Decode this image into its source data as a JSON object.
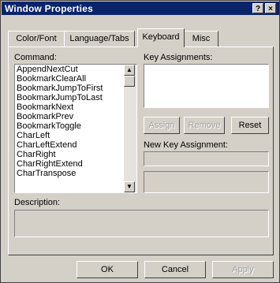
{
  "window": {
    "title": "Window Properties",
    "help_label": "?",
    "close_label": "×"
  },
  "tabs": [
    {
      "label": "Color/Font"
    },
    {
      "label": "Language/Tabs"
    },
    {
      "label": "Keyboard"
    },
    {
      "label": "Misc"
    }
  ],
  "keyboard": {
    "command_label": "Command:",
    "commands": [
      "AppendNextCut",
      "BookmarkClearAll",
      "BookmarkJumpToFirst",
      "BookmarkJumpToLast",
      "BookmarkNext",
      "BookmarkPrev",
      "BookmarkToggle",
      "CharLeft",
      "CharLeftExtend",
      "CharRight",
      "CharRightExtend",
      "CharTranspose"
    ],
    "key_assignments_label": "Key Assignments:",
    "assign_label": "Assign",
    "remove_label": "Remove",
    "reset_label": "Reset",
    "new_key_label": "New Key Assignment:",
    "new_key_value": "",
    "description_label": "Description:",
    "description_value": ""
  },
  "footer": {
    "ok_label": "OK",
    "cancel_label": "Cancel",
    "apply_label": "Apply"
  }
}
